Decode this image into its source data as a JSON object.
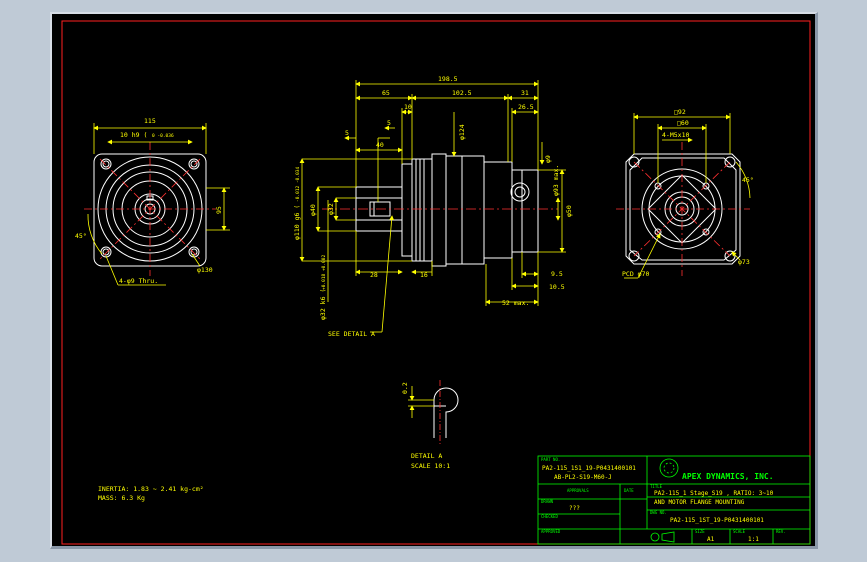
{
  "colors": {
    "background": "#000000",
    "frame_border": "#ff2020",
    "geometry": "#ffffff",
    "dimension": "#ffff00",
    "title_block": "#00ff00",
    "center_line": "#ff3030"
  },
  "left_view": {
    "dim_top": "115",
    "dim_pilot": "10 h9 (",
    "dim_pilot_sub": "0 -0.036",
    "dim_right": "95",
    "dim_angle": "45°",
    "dim_holes": "4-φ9 Thru.",
    "dim_pcd": "φ130"
  },
  "side_view": {
    "dim_overall": "198.5",
    "dim_65": "65",
    "dim_1025": "102.5",
    "dim_31": "31",
    "dim_10": "10",
    "dim_265": "26.5",
    "dim_5a": "5",
    "dim_5b": "5",
    "dim_40": "40",
    "dim_d124": "φ124",
    "dim_d110": "φ110 g6 (",
    "dim_d110_sub": "-0.012 -0.034",
    "dim_d40": "φ40",
    "dim_d32": "φ32",
    "dim_d32k6": "φ32 k6 (",
    "dim_d32k6_sub": "+0.018 +0.002",
    "dim_d9": "φ9",
    "dim_d93": "φ93 max.",
    "dim_d50": "φ50",
    "dim_28": "28",
    "dim_16": "16",
    "dim_95": "9.5",
    "dim_105": "10.5",
    "dim_52max": "52 max.",
    "see_detail": "SEE DETAIL A"
  },
  "right_view": {
    "dim_92": "□92",
    "dim_60": "□60",
    "dim_holes": "4-M5x10",
    "dim_angle": "45°",
    "dim_pcd": "PCD φ70",
    "dim_d73": "φ73"
  },
  "detail": {
    "dim_02": "0.2",
    "title": "DETAIL A",
    "scale": "SCALE 10:1"
  },
  "notes": {
    "inertia": "INERTIA: 1.83 ~ 2.41 kg-cm²",
    "mass": "MASS: 6.3  Kg"
  },
  "title_block": {
    "part_no_label": "PART NO.",
    "part_no_1": "PA2-115_1S1_19-P0431400101",
    "part_no_2": "AB-PL2-S19-M60-J",
    "company": "APEX DYNAMICS, INC.",
    "approvals_label": "APPROVALS",
    "date_label": "DATE",
    "drawn_label": "DRAWN",
    "drawn_value": "???",
    "title_label": "TITLE",
    "title_line1": "PA2-115_1 Stage_S19 , RATIO: 3~10",
    "title_line2": "AND MOTOR FLANGE MOUNTING",
    "checked_label": "CHECKED",
    "dwg_label": "DWG NO.",
    "dwg_no": "PA2-115_1ST_19-P0431400101",
    "approved_label": "APPROVED",
    "size_label": "SIZE",
    "size_value": "A1",
    "scale_label": "SCALE",
    "scale_value": "1:1",
    "rev_label": "REV."
  }
}
